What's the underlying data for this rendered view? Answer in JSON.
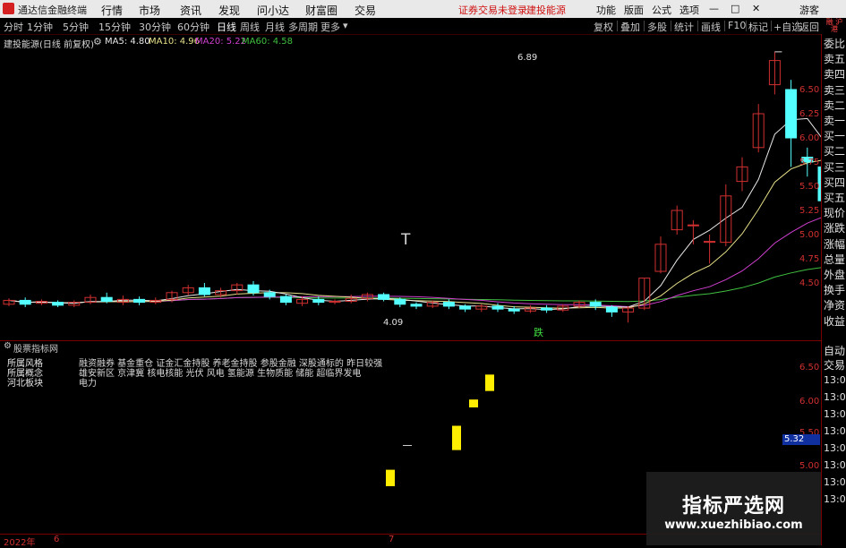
{
  "menubar": {
    "app_title": "通达信金融终端",
    "items": [
      "行情",
      "市场",
      "资讯",
      "发现",
      "问小达",
      "财富圈",
      "交易"
    ],
    "alert1": "证券交易未登录",
    "alert2": "建投能源",
    "right_items": [
      "功能",
      "版面",
      "公式",
      "选项"
    ],
    "guest": "游客"
  },
  "periodbar": {
    "periods": [
      "分时",
      "1分钟",
      "5分钟",
      "15分钟",
      "30分钟",
      "60分钟",
      "日线",
      "周线",
      "月线",
      "多周期",
      "更多"
    ],
    "active": "日线",
    "tools": [
      "复权",
      "叠加",
      "多股",
      "统计",
      "画线",
      "F10",
      "标记",
      "+自选",
      "返回"
    ]
  },
  "chart_header": {
    "stock": "建投能源(日线 前复权)",
    "ma5_label": "MA5: 4.80",
    "ma10_label": "MA10: 4.96",
    "ma20_label": "MA20: 5.22",
    "ma60_label": "MA60: 4.58"
  },
  "annotations": {
    "high": "6.89",
    "low": "4.09",
    "mark_t": "T",
    "mark_die": "跌"
  },
  "lower": {
    "title": "股票指标网",
    "rows": [
      {
        "label": "所属风格",
        "value": "融资融券 基金重仓 证金汇金持股 养老金持股 参股金融 深股通标的 昨日较强"
      },
      {
        "label": "所属概念",
        "value": "雄安新区 京津冀 核电核能 光伏 风电 氢能源 生物质能 储能 超临界发电"
      },
      {
        "label": "河北板块",
        "value": "电力"
      }
    ],
    "price_box": "5.32"
  },
  "date_axis": {
    "year": "2022年",
    "m1": "6",
    "m2": "7"
  },
  "right_panel": {
    "tag": "融 沪港",
    "items": [
      "委比",
      "卖五",
      "卖四",
      "卖三",
      "卖二",
      "卖一",
      "买一",
      "买二",
      "买三",
      "买四",
      "买五",
      "现价",
      "涨跌",
      "涨幅",
      "总量",
      "外盘",
      "换手",
      "净资",
      "收益"
    ],
    "lower_items": [
      "自动",
      "交易"
    ],
    "times": [
      "13:0",
      "13:0",
      "13:0",
      "13:0",
      "13:0",
      "13:0",
      "13:0",
      "13:0"
    ]
  },
  "watermark": {
    "line1": "指标严选网",
    "line2": "www.xuezhibiao.com"
  },
  "chart_data": {
    "type": "candlestick",
    "price_axis_ticks": [
      "6.50",
      "6.25",
      "6.00",
      "5.75",
      "5.50",
      "5.25",
      "5.00",
      "4.75",
      "4.50"
    ],
    "lower_axis_ticks": [
      "6.50",
      "6.00",
      "5.50",
      "5.00"
    ],
    "ylim": [
      4.0,
      7.0
    ],
    "colors": {
      "up": "#d03030",
      "down": "#54ffff",
      "ma5": "#e8e8e8",
      "ma10": "#e6e08a",
      "ma20": "#d040d0",
      "ma60": "#40c040"
    },
    "candles": [
      [
        4.28,
        4.32,
        4.34,
        4.26
      ],
      [
        4.32,
        4.28,
        4.35,
        4.25
      ],
      [
        4.29,
        4.31,
        4.33,
        4.27
      ],
      [
        4.3,
        4.27,
        4.32,
        4.25
      ],
      [
        4.27,
        4.3,
        4.32,
        4.25
      ],
      [
        4.3,
        4.35,
        4.38,
        4.28
      ],
      [
        4.35,
        4.31,
        4.4,
        4.29
      ],
      [
        4.3,
        4.33,
        4.37,
        4.27
      ],
      [
        4.33,
        4.3,
        4.36,
        4.27
      ],
      [
        4.3,
        4.32,
        4.35,
        4.28
      ],
      [
        4.33,
        4.4,
        4.42,
        4.3
      ],
      [
        4.4,
        4.45,
        4.48,
        4.37
      ],
      [
        4.45,
        4.38,
        4.5,
        4.36
      ],
      [
        4.38,
        4.42,
        4.45,
        4.35
      ],
      [
        4.42,
        4.48,
        4.5,
        4.38
      ],
      [
        4.48,
        4.4,
        4.52,
        4.37
      ],
      [
        4.4,
        4.36,
        4.43,
        4.33
      ],
      [
        4.36,
        4.3,
        4.38,
        4.27
      ],
      [
        4.29,
        4.33,
        4.36,
        4.26
      ],
      [
        4.33,
        4.3,
        4.36,
        4.27
      ],
      [
        4.3,
        4.31,
        4.33,
        4.28
      ],
      [
        4.31,
        4.34,
        4.38,
        4.29
      ],
      [
        4.34,
        4.38,
        4.4,
        4.31
      ],
      [
        4.38,
        4.33,
        4.4,
        4.31
      ],
      [
        4.33,
        4.28,
        4.35,
        4.25
      ],
      [
        4.28,
        4.26,
        4.3,
        4.23
      ],
      [
        4.26,
        4.3,
        4.32,
        4.24
      ],
      [
        4.3,
        4.26,
        4.33,
        4.23
      ],
      [
        4.26,
        4.23,
        4.28,
        4.2
      ],
      [
        4.23,
        4.26,
        4.28,
        4.2
      ],
      [
        4.26,
        4.23,
        4.29,
        4.2
      ],
      [
        4.23,
        4.21,
        4.26,
        4.18
      ],
      [
        4.21,
        4.24,
        4.27,
        4.19
      ],
      [
        4.24,
        4.22,
        4.27,
        4.19
      ],
      [
        4.22,
        4.26,
        4.28,
        4.2
      ],
      [
        4.26,
        4.3,
        4.32,
        4.24
      ],
      [
        4.3,
        4.26,
        4.33,
        4.22
      ],
      [
        4.25,
        4.2,
        4.27,
        4.15
      ],
      [
        4.2,
        4.24,
        4.26,
        4.09
      ],
      [
        4.24,
        4.55,
        4.55,
        4.22
      ],
      [
        4.62,
        4.9,
        4.98,
        4.6
      ],
      [
        5.05,
        5.25,
        5.3,
        5.0
      ],
      [
        5.1,
        5.1,
        5.15,
        4.9
      ],
      [
        4.92,
        4.93,
        5.0,
        4.7
      ],
      [
        4.92,
        5.4,
        5.52,
        4.88
      ],
      [
        5.55,
        5.7,
        5.8,
        5.45
      ],
      [
        5.9,
        6.25,
        6.35,
        5.85
      ],
      [
        6.55,
        6.8,
        6.89,
        6.45
      ],
      [
        6.5,
        6.0,
        6.6,
        5.7
      ],
      [
        5.8,
        5.75,
        5.9,
        5.6
      ],
      [
        5.7,
        5.35,
        5.75,
        5.3
      ],
      [
        5.1,
        5.0,
        5.18,
        4.95
      ],
      [
        5.13,
        5.15,
        5.25,
        5.1
      ],
      [
        5.2,
        5.05,
        5.22,
        5.0
      ],
      [
        5.0,
        5.05,
        5.15,
        4.95
      ],
      [
        5.05,
        5.2,
        5.3,
        5.02
      ],
      [
        5.22,
        5.3,
        5.52,
        5.1
      ],
      [
        5.25,
        5.0,
        5.28,
        4.95
      ],
      [
        4.97,
        4.98,
        5.02,
        4.9
      ],
      [
        5.0,
        4.92,
        5.05,
        4.88
      ],
      [
        4.95,
        4.92,
        4.98,
        4.88
      ],
      [
        4.92,
        4.92,
        4.95,
        4.88
      ],
      [
        4.92,
        4.85,
        4.95,
        4.8
      ],
      [
        4.85,
        4.65,
        4.88,
        4.62
      ],
      [
        4.6,
        4.58,
        4.62,
        4.55
      ]
    ],
    "lower_bars": [
      {
        "from": 4.7,
        "to": 4.95
      },
      {
        "from": 5.25,
        "to": 5.62
      },
      {
        "from": 5.9,
        "to": 6.02
      },
      {
        "from": 6.15,
        "to": 6.4
      }
    ],
    "lower_dash": 5.32
  }
}
